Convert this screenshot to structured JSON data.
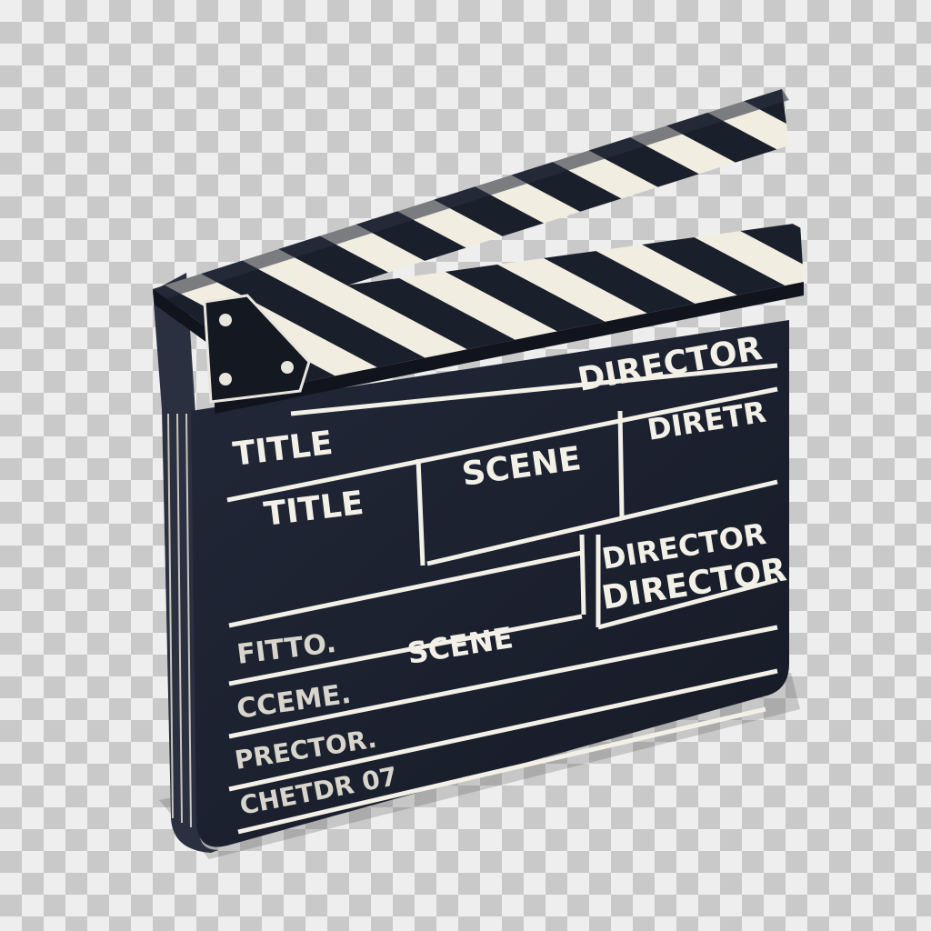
{
  "clapperboard": {
    "labels": {
      "director_top": "DIRECTOR",
      "title_header": "TITLE",
      "scene_header": "SCENE",
      "director_header": "DIRETR",
      "title_value": "TITLE",
      "director_line1": "DIRECTOR",
      "director_line2": "DIRECTOR",
      "fitto": "FITTO.",
      "scene_middle": "SCENE",
      "sceme": "CCEME.",
      "prector": "PRECTOR.",
      "chetdr": "CHETDR 07"
    },
    "colors": {
      "board": "#1c2130",
      "stripe_light": "#f1ede0",
      "stripe_dark": "#1a1f2c",
      "lines": "#f3f0e8"
    }
  }
}
